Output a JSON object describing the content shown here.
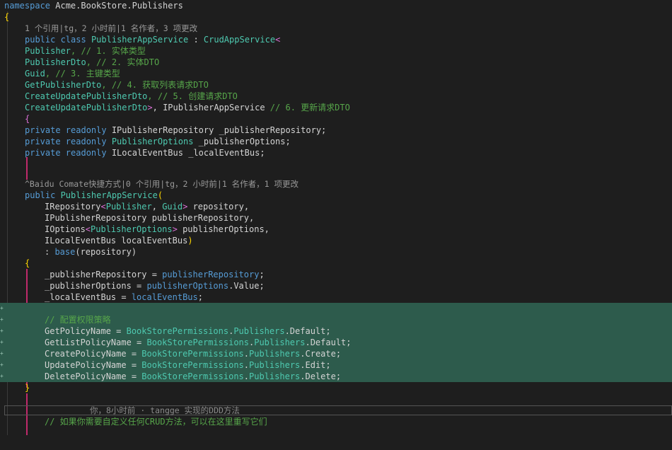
{
  "editor": {
    "lines": {
      "l1": {
        "kw": "namespace",
        "name": " Acme.BookStore.Publishers"
      },
      "l2": {
        "brace": "{"
      },
      "l3": {
        "lens": "1 个引用|tg，2 小时前|1 名作者，3 项更改"
      },
      "l4": {
        "kw1": "public",
        "kw2": " class",
        "cls": " PublisherAppService",
        "rest": " : ",
        "base": "CrudAppService",
        "lt": "<"
      },
      "l5": {
        "type": "Publisher",
        "cmt": ", // 1. 实体类型"
      },
      "l6": {
        "type": "PublisherDto",
        "cmt": ", // 2. 实体DTO"
      },
      "l7": {
        "type": "Guid",
        "cmt": ", // 3. 主键类型"
      },
      "l8": {
        "type": "GetPublisherDto",
        "cmt": ", // 4. 获取列表请求DTO"
      },
      "l9": {
        "type": "CreateUpdatePublisherDto",
        "cmt": ", // 5. 创建请求DTO"
      },
      "l10": {
        "type": "CreateUpdatePublisherDto",
        "gt": ">",
        "sep": ", ",
        "iface": "IPublisherAppService",
        "cmt": " // 6. 更新请求DTO"
      },
      "l11": {
        "brace": "{"
      },
      "l12": {
        "kw1": "private",
        "kw2": " readonly",
        "type": " IPublisherRepository",
        "field": " _publisherRepository;"
      },
      "l13": {
        "kw1": "private",
        "kw2": " readonly",
        "type": " PublisherOptions",
        "field": " _publisherOptions;"
      },
      "l14": {
        "kw1": "private",
        "kw2": " readonly",
        "type": " ILocalEventBus",
        "field": " _localEventBus;"
      },
      "l15": {
        "lens": "^Baidu Comate快捷方式|0 个引用|tg，2 小时前|1 名作者，1 项更改"
      },
      "l16": {
        "kw": "public",
        "ctor": " PublisherAppService",
        "paren": "("
      },
      "l17": {
        "t1": "IRepository",
        "lt": "<",
        "t2": "Publisher",
        "sep": ", ",
        "t3": "Guid",
        "gt": ">",
        "p": " repository,"
      },
      "l18": {
        "t1": "IPublisherRepository",
        "p": " publisherRepository,"
      },
      "l19": {
        "t1": "IOptions",
        "lt": "<",
        "t2": "PublisherOptions",
        "gt": ">",
        "p": " publisherOptions,"
      },
      "l20": {
        "t1": "ILocalEventBus",
        "p": " localEventBus",
        "paren": ")"
      },
      "l21": {
        "colon": ": ",
        "kw": "base",
        "p": "(repository)"
      },
      "l22": {
        "brace": "{"
      },
      "l23": {
        "a": "_publisherRepository = ",
        "b": "publisherRepository",
        "c": ";"
      },
      "l24": {
        "a": "_publisherOptions = ",
        "b": "publisherOptions",
        "c": ".Value;"
      },
      "l25": {
        "a": "_localEventBus = ",
        "b": "localEventBus",
        "c": ";"
      },
      "l26": {
        "cmt": "// 配置权限策略"
      },
      "l27": {
        "a": "GetPolicyName = ",
        "t1": "BookStorePermissions",
        "d1": ".",
        "t2": "Publishers",
        "c": ".Default;"
      },
      "l28": {
        "a": "GetListPolicyName = ",
        "t1": "BookStorePermissions",
        "d1": ".",
        "t2": "Publishers",
        "c": ".Default;"
      },
      "l29": {
        "a": "CreatePolicyName = ",
        "t1": "BookStorePermissions",
        "d1": ".",
        "t2": "Publishers",
        "c": ".Create;"
      },
      "l30": {
        "a": "UpdatePolicyName = ",
        "t1": "BookStorePermissions",
        "d1": ".",
        "t2": "Publishers",
        "c": ".Edit;"
      },
      "l31": {
        "a": "DeletePolicyName = ",
        "t1": "BookStorePermissions",
        "d1": ".",
        "t2": "Publishers",
        "c": ".Delete;"
      },
      "l32": {
        "brace": "}"
      },
      "l33": {
        "cmt": "// 如果你需要自定义任何CRUD方法，可以在这里重写它们"
      }
    },
    "blame": "你，8小时前 · tangge 实现的DDD方法",
    "added_marker": "+"
  },
  "colors": {
    "keyword": "#569cd6",
    "type": "#4ec9b0",
    "comment": "#57a64a",
    "added_bg": "#2d5b4c",
    "change_bar": "#c02a6b"
  }
}
